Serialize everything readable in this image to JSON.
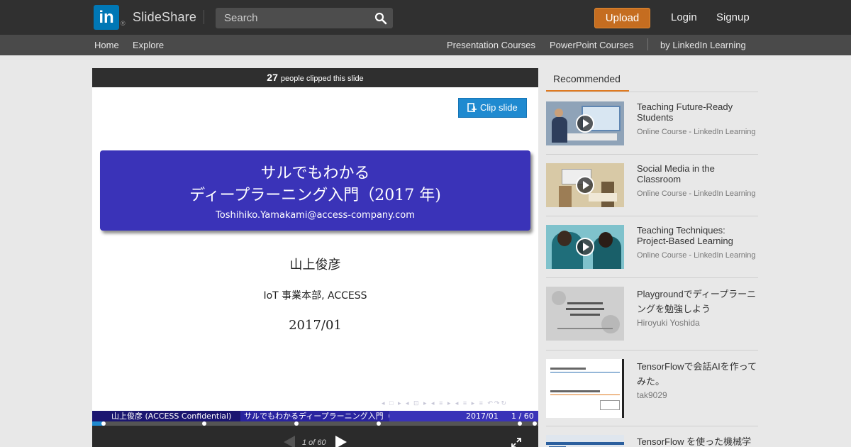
{
  "header": {
    "logo_mark": "in",
    "logo_reg": "®",
    "logo_text": "SlideShare",
    "search_placeholder": "Search",
    "upload_label": "Upload",
    "login_label": "Login",
    "signup_label": "Signup",
    "icons": {
      "search": "search-icon"
    }
  },
  "subnav": {
    "home": "Home",
    "explore": "Explore",
    "presentation_courses": "Presentation Courses",
    "powerpoint_courses": "PowerPoint Courses",
    "by_linkedin": "by LinkedIn Learning"
  },
  "slide": {
    "clip_count": "27",
    "clip_count_text": "people clipped this slide",
    "clip_button": "Clip slide",
    "title_line1": "サルでもわかる",
    "title_line2": "ディープラーニング入門（2017 年)",
    "email": "Toshihiko.Yamakami@access-company.com",
    "author": "山上俊彦",
    "affiliation": "IoT 事業本部, ACCESS",
    "date": "2017/01",
    "footer_left": "山上俊彦 (ACCESS Confidential)",
    "footer_middle": "サルでもわかるディープラーニング入門（20",
    "footer_date": "2017/01",
    "footer_page": "1 / 60",
    "beamer_nav": "◂ □ ▸ ◂ ⊡ ▸ ◂ ≡ ▸ ◂ ≡ ▸   ≡   ↶↷↻"
  },
  "player": {
    "page_indicator": "1 of 60",
    "progress": 0.025,
    "colors": {
      "progress": "#1f8ad0",
      "accent": "#e07a20",
      "brand": "#0077b5",
      "upload": "#c56d20"
    }
  },
  "recommended": {
    "tab_label": "Recommended",
    "items": [
      {
        "title": "Teaching Future-Ready Students",
        "subtitle": "Online Course - LinkedIn Learning",
        "video": true
      },
      {
        "title": "Social Media in the Classroom",
        "subtitle": "Online Course - LinkedIn Learning",
        "video": true
      },
      {
        "title": "Teaching Techniques: Project-Based Learning",
        "subtitle": "Online Course - LinkedIn Learning",
        "video": true
      },
      {
        "title": "Playgroundでディープラーニングを勉強しよう",
        "subtitle": "Hiroyuki Yoshida",
        "video": false
      },
      {
        "title": "TensorFlowで会話AIを作ってみた。",
        "subtitle": "tak9029",
        "video": false
      },
      {
        "title": "TensorFlow を使った機械学",
        "subtitle": "",
        "video": false
      }
    ]
  }
}
